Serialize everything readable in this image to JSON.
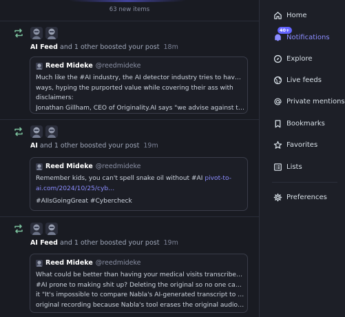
{
  "feed": {
    "new_items_label": "63 new items",
    "notifications": [
      {
        "who": "AI Feed",
        "action": "and 1 other boosted your post",
        "time": "18m",
        "card": {
          "name": "Reed Mideke",
          "handle": "@reedmideke",
          "lines": [
            "Much like the #AI industry, the AI detector industry tries to have it both",
            "ways, hyping the purported value while covering their ass with",
            "disclaimers:",
            "Jonathan Gillham, CEO of Originality.AI says \"we advise against the …"
          ]
        }
      },
      {
        "who": "AI",
        "action": "and 1 other boosted your post",
        "time": "19m",
        "card": {
          "name": "Reed Mideke",
          "handle": "@reedmideke",
          "line1_text": "Remember kids, you can't spell snake oil without #AI ",
          "line1_link": "pivot-to-",
          "line2_link": "ai.com/2024/10/25/cyb…",
          "tags": "#AIIsGoingGreat #Cybercheck"
        }
      },
      {
        "who": "AI Feed",
        "action": "and 1 other boosted your post",
        "time": "19m",
        "card": {
          "name": "Reed Mideke",
          "handle": "@reedmideke",
          "lines": [
            "What could be better than having your medical visits transcribed by an",
            "#AI prone to making shit up? Deleting the original so no one can prove",
            "it \"It's impossible to compare Nabla's AI-generated transcript to the",
            "original recording because Nabla's tool erases the original audio for …"
          ]
        }
      }
    ]
  },
  "sidebar": {
    "items": [
      {
        "label": "Home",
        "icon": "home-icon"
      },
      {
        "label": "Notifications",
        "icon": "bell-icon",
        "badge": "40+"
      },
      {
        "label": "Explore",
        "icon": "compass-icon"
      },
      {
        "label": "Live feeds",
        "icon": "globe-icon"
      },
      {
        "label": "Private mentions",
        "icon": "at-icon"
      },
      {
        "label": "Bookmarks",
        "icon": "bookmark-icon"
      },
      {
        "label": "Favorites",
        "icon": "star-icon"
      },
      {
        "label": "Lists",
        "icon": "list-icon"
      },
      {
        "label": "Preferences",
        "icon": "gear-icon"
      }
    ]
  },
  "colors": {
    "accent": "#8c8dff",
    "boost_green": "#79bd9a",
    "background": "#191b22"
  }
}
